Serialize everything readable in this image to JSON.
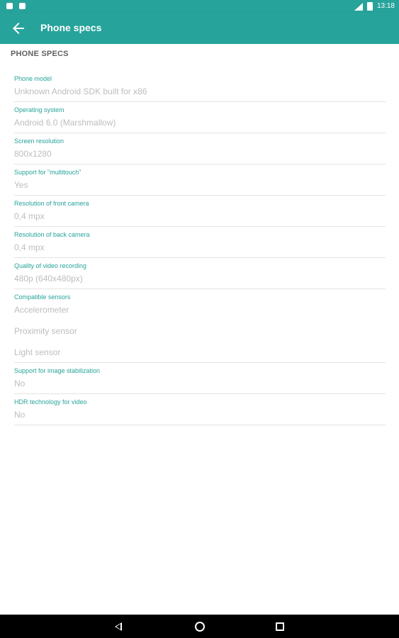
{
  "status_bar": {
    "time": "13:18",
    "icons": [
      "notification-icon",
      "notification-icon",
      "signal-icon",
      "battery-icon"
    ]
  },
  "app_bar": {
    "title": "Phone specs",
    "back_icon": "arrow-back-icon"
  },
  "section": {
    "header": "PHONE SPECS"
  },
  "specs": [
    {
      "label": "Phone model",
      "values": [
        "Unknown Android SDK built for x86"
      ]
    },
    {
      "label": "Operating system",
      "values": [
        "Android 6.0 (Marshmallow)"
      ]
    },
    {
      "label": "Screen resolution",
      "values": [
        "800x1280"
      ]
    },
    {
      "label": "Support for \"multitouch\"",
      "values": [
        "Yes"
      ]
    },
    {
      "label": "Resolution of front camera",
      "values": [
        "0,4 mpx"
      ]
    },
    {
      "label": "Resolution of back camera",
      "values": [
        "0,4 mpx"
      ]
    },
    {
      "label": "Quality of video recording",
      "values": [
        "480p (640x480px)"
      ]
    },
    {
      "label": "Compatible sensors",
      "values": [
        "Accelerometer",
        "Proximity sensor",
        "Light sensor"
      ]
    },
    {
      "label": "Support for image stabilization",
      "values": [
        "No"
      ]
    },
    {
      "label": "HDR technology for video",
      "values": [
        "No"
      ]
    }
  ],
  "nav_bar": {
    "icons": [
      "back-triangle-icon",
      "home-circle-icon",
      "recents-square-icon"
    ]
  },
  "colors": {
    "accent": "#26a39a",
    "value_text": "#bdbdbd",
    "divider": "#e4e4e4"
  }
}
